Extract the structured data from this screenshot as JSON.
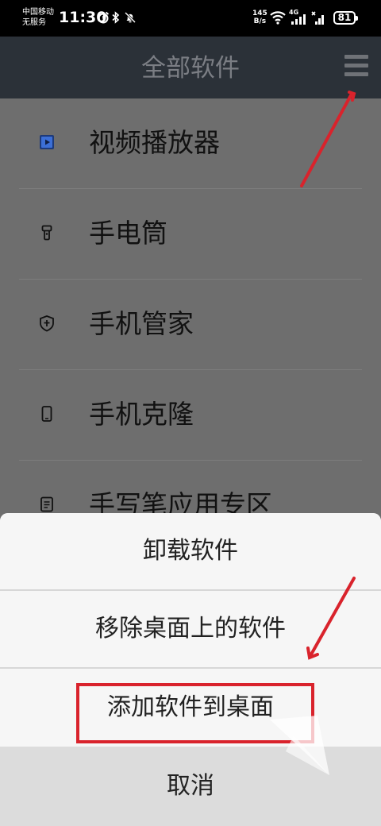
{
  "status_bar": {
    "carrier_line1": "中国移动",
    "carrier_line2": "无服务",
    "time": "11:30",
    "net_speed_value": "145",
    "net_speed_unit": "B/s",
    "network_type": "4G",
    "battery": "81"
  },
  "header": {
    "title": "全部软件",
    "menu_icon": "hamburger-menu-icon"
  },
  "app_list": [
    {
      "label": "视频播放器",
      "icon": "video-player-icon"
    },
    {
      "label": "手电筒",
      "icon": "flashlight-icon"
    },
    {
      "label": "手机管家",
      "icon": "shield-icon"
    },
    {
      "label": "手机克隆",
      "icon": "phone-icon"
    },
    {
      "label": "手写笔应用专区",
      "icon": "note-icon"
    }
  ],
  "action_sheet": {
    "uninstall": "卸载软件",
    "remove_from_desktop": "移除桌面上的软件",
    "add_to_desktop": "添加软件到桌面",
    "cancel": "取消"
  },
  "colors": {
    "annotation_red": "#d9232c",
    "header_bg": "#2b3138",
    "dim_overlay": "#6e6e6e"
  }
}
